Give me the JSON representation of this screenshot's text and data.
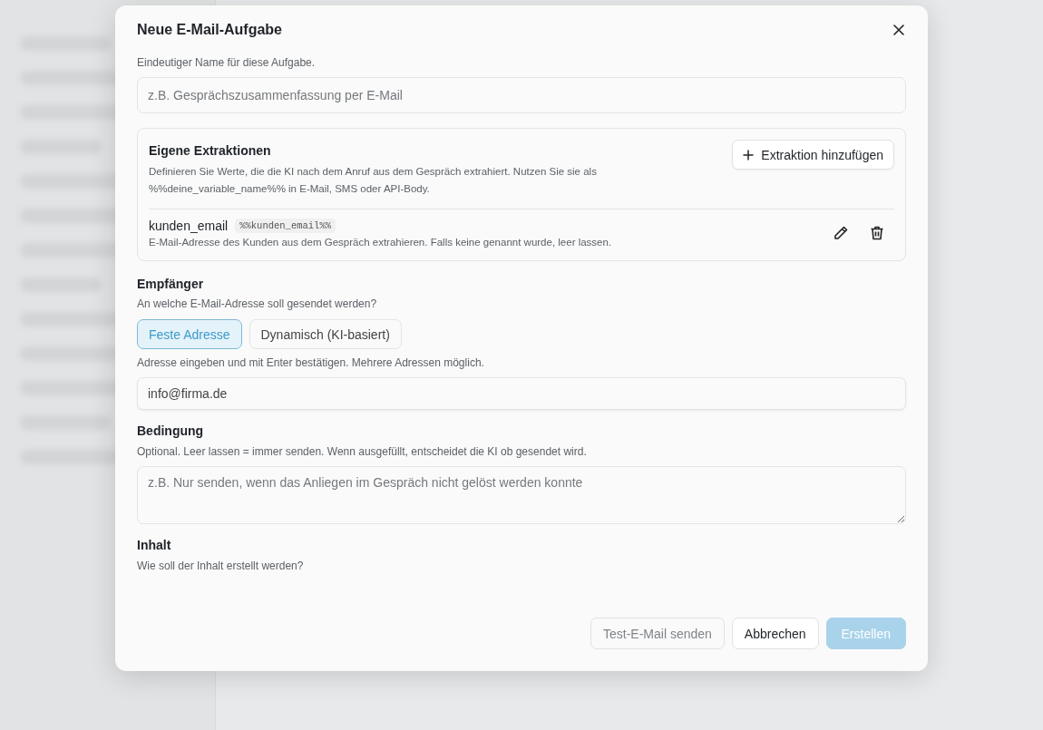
{
  "dialog": {
    "title": "Neue E-Mail-Aufgabe",
    "name_hint": "Eindeutiger Name für diese Aufgabe.",
    "name_field": {
      "placeholder": "z.B. Gesprächszusammenfassung per E-Mail"
    },
    "extractions": {
      "title": "Eigene Extraktionen",
      "add_button": "Extraktion hinzufügen",
      "description": "Definieren Sie Werte, die die KI nach dem Anruf aus dem Gespräch extrahiert. Nutzen Sie sie als %%deine_variable_name%% in E-Mail, SMS oder API-Body.",
      "items": [
        {
          "name": "kunden_email",
          "variable": "%%kunden_email%%",
          "description": "E-Mail-Adresse des Kunden aus dem Gespräch extrahieren. Falls keine genannt wurde, leer lassen."
        }
      ]
    },
    "recipient": {
      "title": "Empfänger",
      "hint": "An welche E-Mail-Adresse soll gesendet werden?",
      "modes": [
        {
          "label": "Feste Adresse",
          "selected": true
        },
        {
          "label": "Dynamisch (KI-basiert)",
          "selected": false
        }
      ],
      "address_hint": "Adresse eingeben und mit Enter bestätigen. Mehrere Adressen möglich.",
      "address_field": {
        "value": "info@firma.de"
      }
    },
    "condition": {
      "title": "Bedingung",
      "hint": "Optional. Leer lassen = immer senden. Wenn ausgefüllt, entscheidet die KI ob gesendet wird.",
      "field": {
        "placeholder": "z.B. Nur senden, wenn das Anliegen im Gespräch nicht gelöst werden konnte"
      }
    },
    "content": {
      "title": "Inhalt",
      "hint": "Wie soll der Inhalt erstellt werden?"
    },
    "buttons": [
      {
        "label": "Test-E-Mail senden",
        "kind": "secondary",
        "disabled": true
      },
      {
        "label": "Abbrechen",
        "kind": "secondary",
        "disabled": false
      },
      {
        "label": "Erstellen",
        "kind": "primary",
        "disabled": true
      }
    ]
  }
}
